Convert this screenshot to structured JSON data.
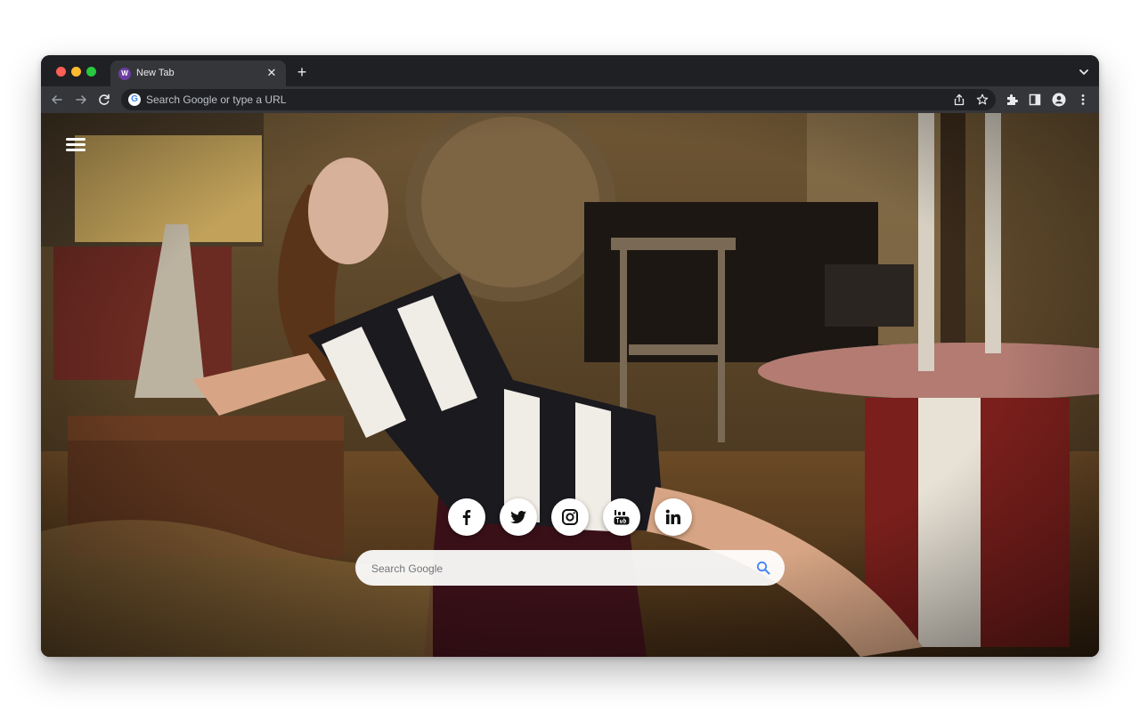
{
  "browser": {
    "tab": {
      "title": "New Tab",
      "favicon_letter": "W",
      "close_glyph": "✕"
    },
    "new_tab_glyph": "+",
    "omnibox": {
      "placeholder": "Search Google or type a URL",
      "provider_letter": "G"
    },
    "icons": [
      "back-icon",
      "forward-icon",
      "reload-icon",
      "share-icon",
      "star-icon",
      "extensions-icon",
      "side-panel-icon",
      "profile-icon",
      "more-menu-icon",
      "tab-search-icon"
    ]
  },
  "page": {
    "menu_icon": "hamburger-icon",
    "social_links": [
      {
        "name": "facebook",
        "icon": "facebook-icon"
      },
      {
        "name": "twitter",
        "icon": "twitter-icon"
      },
      {
        "name": "instagram",
        "icon": "instagram-icon"
      },
      {
        "name": "youtube",
        "icon": "youtube-icon"
      },
      {
        "name": "linkedin",
        "icon": "linkedin-icon"
      }
    ],
    "search": {
      "placeholder": "Search Google"
    },
    "background": "photo-background"
  },
  "colors": {
    "tabstrip": "#1f2023",
    "toolbar": "#35363a",
    "omnibox": "#202124",
    "search_icon": "#4285f4",
    "tab_favicon": "#6a3ea1"
  }
}
